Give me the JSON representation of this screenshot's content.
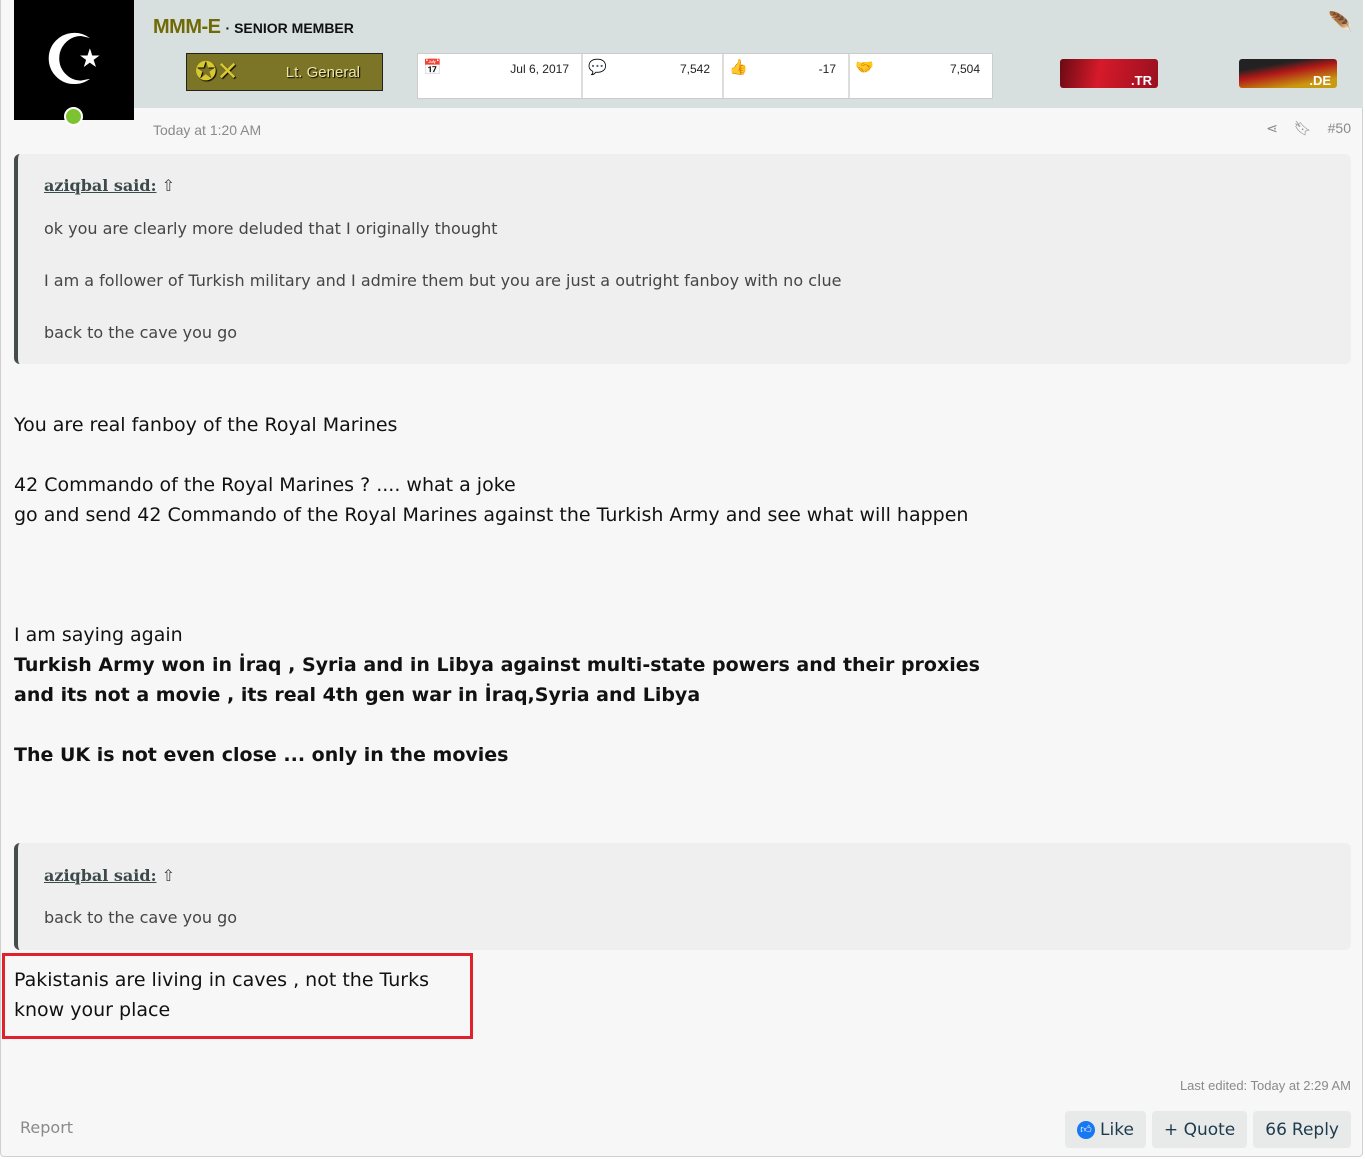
{
  "user": {
    "name": "MMM-E",
    "title": "· SENIOR MEMBER",
    "rank": "Lt. General"
  },
  "stats": [
    {
      "icon": "calendar-icon",
      "value": "Jul 6, 2017"
    },
    {
      "icon": "messages-icon",
      "value": "7,542"
    },
    {
      "icon": "thumbs-up-icon",
      "value": "-17"
    },
    {
      "icon": "handshake-icon",
      "value": "7,504"
    }
  ],
  "flags": [
    ".TR",
    ".DE"
  ],
  "post": {
    "time": "Today at 1:20 AM",
    "number": "#50",
    "edited": "Last edited: Today at 2:29 AM"
  },
  "quote1": {
    "author": "aziqbal said:",
    "lines": [
      "ok you are clearly more deluded that I originally thought",
      "I am a follower of Turkish military and I admire them but you are just a outright fanboy with no clue",
      "back to the cave you go"
    ]
  },
  "body1": [
    "You are real fanboy of the Royal Marines",
    "42 Commando of the Royal Marines ? .... what a joke",
    "go and send 42 Commando of the Royal Marines against the Turkish Army and see what will happen",
    "I am saying again"
  ],
  "body_bold": [
    "Turkish Army won in İraq , Syria and in Libya against multi-state powers and their proxies",
    "and its not a movie , its real 4th gen war in İraq,Syria and Libya",
    "The UK is not even close ... only in the movies"
  ],
  "quote2": {
    "author": "aziqbal said:",
    "lines": [
      "back to the cave you go"
    ]
  },
  "body2": [
    "Pakistanis are living in caves , not the Turks",
    "know your place"
  ],
  "actions": {
    "report": "Report",
    "like": "Like",
    "quote": "+ Quote",
    "reply": "Reply"
  },
  "colors": {
    "highlight": "#e1212b",
    "username": "#6f6a06",
    "like": "#1877f2"
  }
}
